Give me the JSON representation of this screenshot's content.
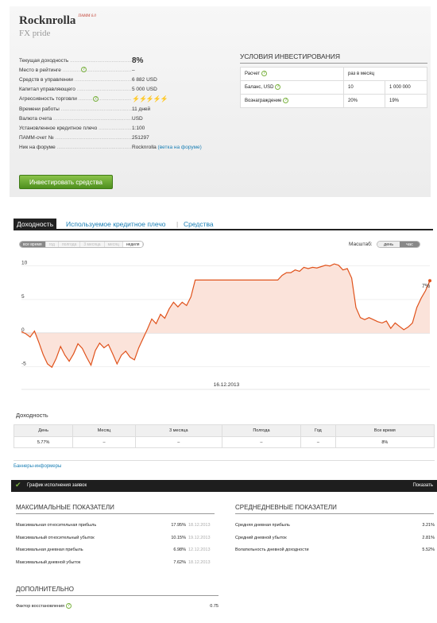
{
  "account": {
    "name": "Rocknrolla",
    "pamm_version": "ПАММ 6.0",
    "strategy": "FX pride"
  },
  "info_rows": [
    {
      "label": "Текущая доходность",
      "value": "8%"
    },
    {
      "label": "Место в рейтинге",
      "value": "–"
    },
    {
      "label": "Средств в управлении",
      "value": "6 882 USD"
    },
    {
      "label": "Капитал управляющего",
      "value": "5 000 USD"
    },
    {
      "label": "Агрессивность торговли",
      "value": "aggression_level",
      "level": 4,
      "max_level": 5
    },
    {
      "label": "Времени работы",
      "value": "11 дней"
    },
    {
      "label": "Валюта счета",
      "value": "USD"
    },
    {
      "label": "Установленное кредитное плечо",
      "value": "1:100"
    },
    {
      "label": "ПАММ-счет №",
      "value": "251297"
    },
    {
      "label": "Ник на форуме",
      "value": "Rocknrolla",
      "link": "(ветка на форуме)"
    }
  ],
  "invest_button": "Инвестировать средства",
  "conditions": {
    "title": "УСЛОВИЯ ИНВЕСТИРОВАНИЯ",
    "rows": [
      [
        "Расчет",
        "раз в месяц",
        ""
      ],
      [
        "Баланс, USD",
        "10",
        "1 000 000"
      ],
      [
        "Вознаграждение",
        "20%",
        "19%"
      ]
    ]
  },
  "tabs": [
    "Доходность",
    "Используемое кредитное плечо",
    "Средства"
  ],
  "period_buttons": [
    "все время",
    "год",
    "полгода",
    "3 месяца",
    "месяц",
    "неделя"
  ],
  "scale": {
    "label": "Масштаб:",
    "options": [
      "день",
      "час"
    ]
  },
  "chart_data": {
    "type": "line",
    "y_ticks": [
      "10",
      "5",
      "0",
      "-5"
    ],
    "ylim": [
      -6.5,
      11.5
    ],
    "x_label": "16.12.2013",
    "end_label": "7%",
    "colors": {
      "line": "#e0521b",
      "fill": "#fbe3da"
    },
    "values": [
      0.2,
      -0.1,
      -0.6,
      0.3,
      -1.4,
      -3.2,
      -4.6,
      -5.1,
      -3.8,
      -2.0,
      -3.3,
      -4.2,
      -3.1,
      -1.6,
      -2.3,
      -3.6,
      -4.8,
      -2.6,
      -1.5,
      -2.2,
      -1.7,
      -3.1,
      -4.6,
      -3.3,
      -2.7,
      -3.6,
      -4.0,
      -2.2,
      -0.8,
      0.6,
      2.1,
      1.4,
      2.8,
      2.2,
      3.6,
      4.6,
      3.9,
      4.6,
      4.1,
      5.4,
      7.9,
      7.9,
      7.9,
      7.9,
      7.9,
      7.9,
      7.9,
      7.9,
      7.9,
      7.9,
      7.9,
      7.9,
      7.9,
      7.9,
      7.9,
      7.9,
      7.9,
      7.9,
      7.9,
      7.9,
      8.6,
      9.0,
      9.0,
      9.4,
      9.2,
      9.8,
      9.6,
      9.8,
      9.7,
      9.9,
      10.1,
      10.0,
      10.3,
      10.1,
      9.4,
      9.6,
      8.2,
      3.8,
      2.3,
      2.0,
      2.3,
      2.0,
      1.7,
      1.5,
      1.8,
      0.7,
      1.5,
      1.0,
      0.5,
      0.9,
      1.5,
      3.8,
      5.2,
      6.3,
      7.8
    ],
    "avg_daily": [
      "5.77%",
      "–",
      "–",
      "–",
      "–",
      "8%"
    ]
  },
  "returns_title": "Доходность",
  "returns_headers": [
    "День",
    "Месяц",
    "3 месяца",
    "Полгода",
    "Год",
    "Все время"
  ],
  "banners": "Баннеры-информеры",
  "orders_bar": {
    "label": "График исполнения заявок",
    "show": "Показать"
  },
  "max_stats": {
    "title": "МАКСИМАЛЬНЫЕ ПОКАЗАТЕЛИ",
    "rows": [
      {
        "label": "Максимальная относительная прибыль",
        "value": "17.95%",
        "date": "18.12.2013"
      },
      {
        "label": "Максимальный относительный убыток",
        "value": "10.15%",
        "date": "19.12.2013"
      },
      {
        "label": "Максимальная дневная прибыль",
        "value": "6.98%",
        "date": "12.12.2013"
      },
      {
        "label": "Максимальный дневной убыток",
        "value": "7.62%",
        "date": "18.12.2013"
      }
    ]
  },
  "avg_stats": {
    "title": "СРЕДНЕДНЕВНЫЕ ПОКАЗАТЕЛИ",
    "rows": [
      {
        "label": "Средняя дневная прибыль",
        "value": "3.21%"
      },
      {
        "label": "Средний дневной убыток",
        "value": "2.81%"
      },
      {
        "label": "Волатильность дневной доходности",
        "value": "5.52%"
      }
    ]
  },
  "extra": {
    "title": "ДОПОЛНИТЕЛЬНО",
    "rows": [
      {
        "label": "Фактор восстановления",
        "value": "0.75"
      }
    ]
  }
}
